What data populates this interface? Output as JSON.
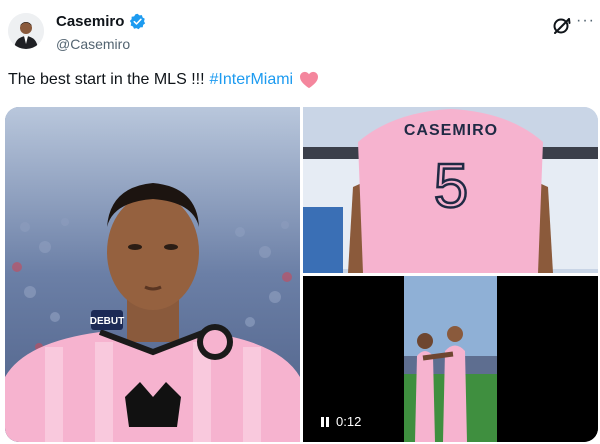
{
  "user": {
    "display_name": "Casemiro",
    "handle": "@Casemiro",
    "verified": true
  },
  "tweet": {
    "text": "The best start in the MLS !!!",
    "hashtag": "#InterMiami",
    "emoji": "pink-heart"
  },
  "media": {
    "jersey_name": "CASEMIRO",
    "jersey_number": "5",
    "sleeve_badge": "DEBUT",
    "video_duration": "0:12"
  },
  "colors": {
    "hashtag_blue": "#1d9bf0",
    "verified_blue": "#1d9bf0",
    "kit_pink": "#f6b3cf",
    "heart_pink": "#f4869d",
    "text_dark": "#0f1419",
    "text_gray": "#536471"
  },
  "icons": [
    "verified-badge-icon",
    "grok-icon",
    "more-options-icon",
    "pink-heart-icon",
    "pause-icon"
  ]
}
